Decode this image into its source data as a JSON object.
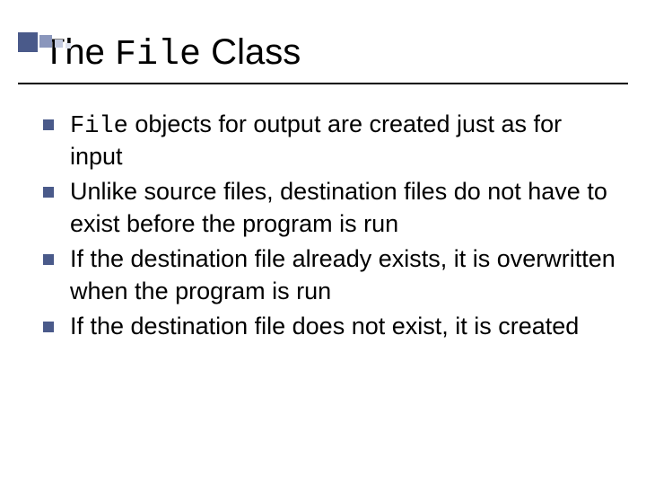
{
  "title": {
    "pre": "The ",
    "code": "File",
    "post": " Class"
  },
  "bullets": [
    {
      "code": "File",
      "text": " objects for output are created just as for input"
    },
    {
      "code": "",
      "text": "Unlike source files, destination files do not have to exist before the program is run"
    },
    {
      "code": "",
      "text": "If the destination file already exists, it is overwritten when the program is run"
    },
    {
      "code": "",
      "text": "If the destination file does not exist, it is created"
    }
  ]
}
